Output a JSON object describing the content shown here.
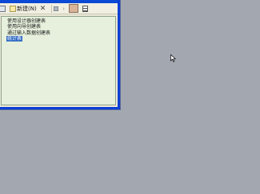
{
  "window": {
    "title": ""
  },
  "toolbar": {
    "new_label": "新建(N)",
    "delete_icon": "delete-icon"
  },
  "list": {
    "items": [
      {
        "label": "使用设计器创建表"
      },
      {
        "label": "使用向导创建表"
      },
      {
        "label": "通过输入数据创建表"
      },
      {
        "label": "统计表",
        "selected": true
      }
    ]
  },
  "colors": {
    "desktop": "#a3a8b0",
    "title_bar": "#0b4fe0",
    "pane_background": "#e6f0dc",
    "selection": "#316ac5"
  }
}
